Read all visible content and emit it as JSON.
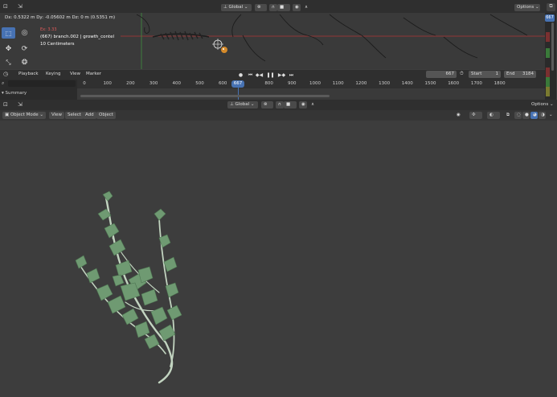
{
  "graph_editor": {
    "transform_orientation": "Global",
    "options_label": "Options",
    "readout_delta": "Dx: 0.5322 m  Dy: -0.05602 m  Dz: 0 m (0.5351 m)",
    "current_frame_overlay": "Ex: 3.33",
    "active_object": "(667) branch.002 | growth_contel",
    "scale_note": "10 Centimeters",
    "current_frame_badge": "667"
  },
  "timeline": {
    "menus": [
      "Playback",
      "Keying",
      "View",
      "Marker"
    ],
    "current_frame": "667",
    "start_label": "Start",
    "start_value": "1",
    "end_label": "End",
    "end_value": "3184",
    "ticks": [
      "0",
      "100",
      "200",
      "300",
      "400",
      "500",
      "600",
      "667",
      "800",
      "900",
      "1000",
      "1100",
      "1200",
      "1300",
      "1400",
      "1500",
      "1600",
      "1700",
      "1800"
    ],
    "summary_label": "Summary"
  },
  "viewport": {
    "transform_orientation": "Global",
    "options_label": "Options",
    "mode": "Object Mode",
    "menus": [
      "View",
      "Select",
      "Add",
      "Object"
    ]
  },
  "colors": {
    "accent": "#4772b3",
    "playhead": "#4772b3",
    "curve_red": "#c83c3c",
    "curve_green": "#4aa04a",
    "leaf": "#6f9a72",
    "stem": "#c2d4c0"
  }
}
